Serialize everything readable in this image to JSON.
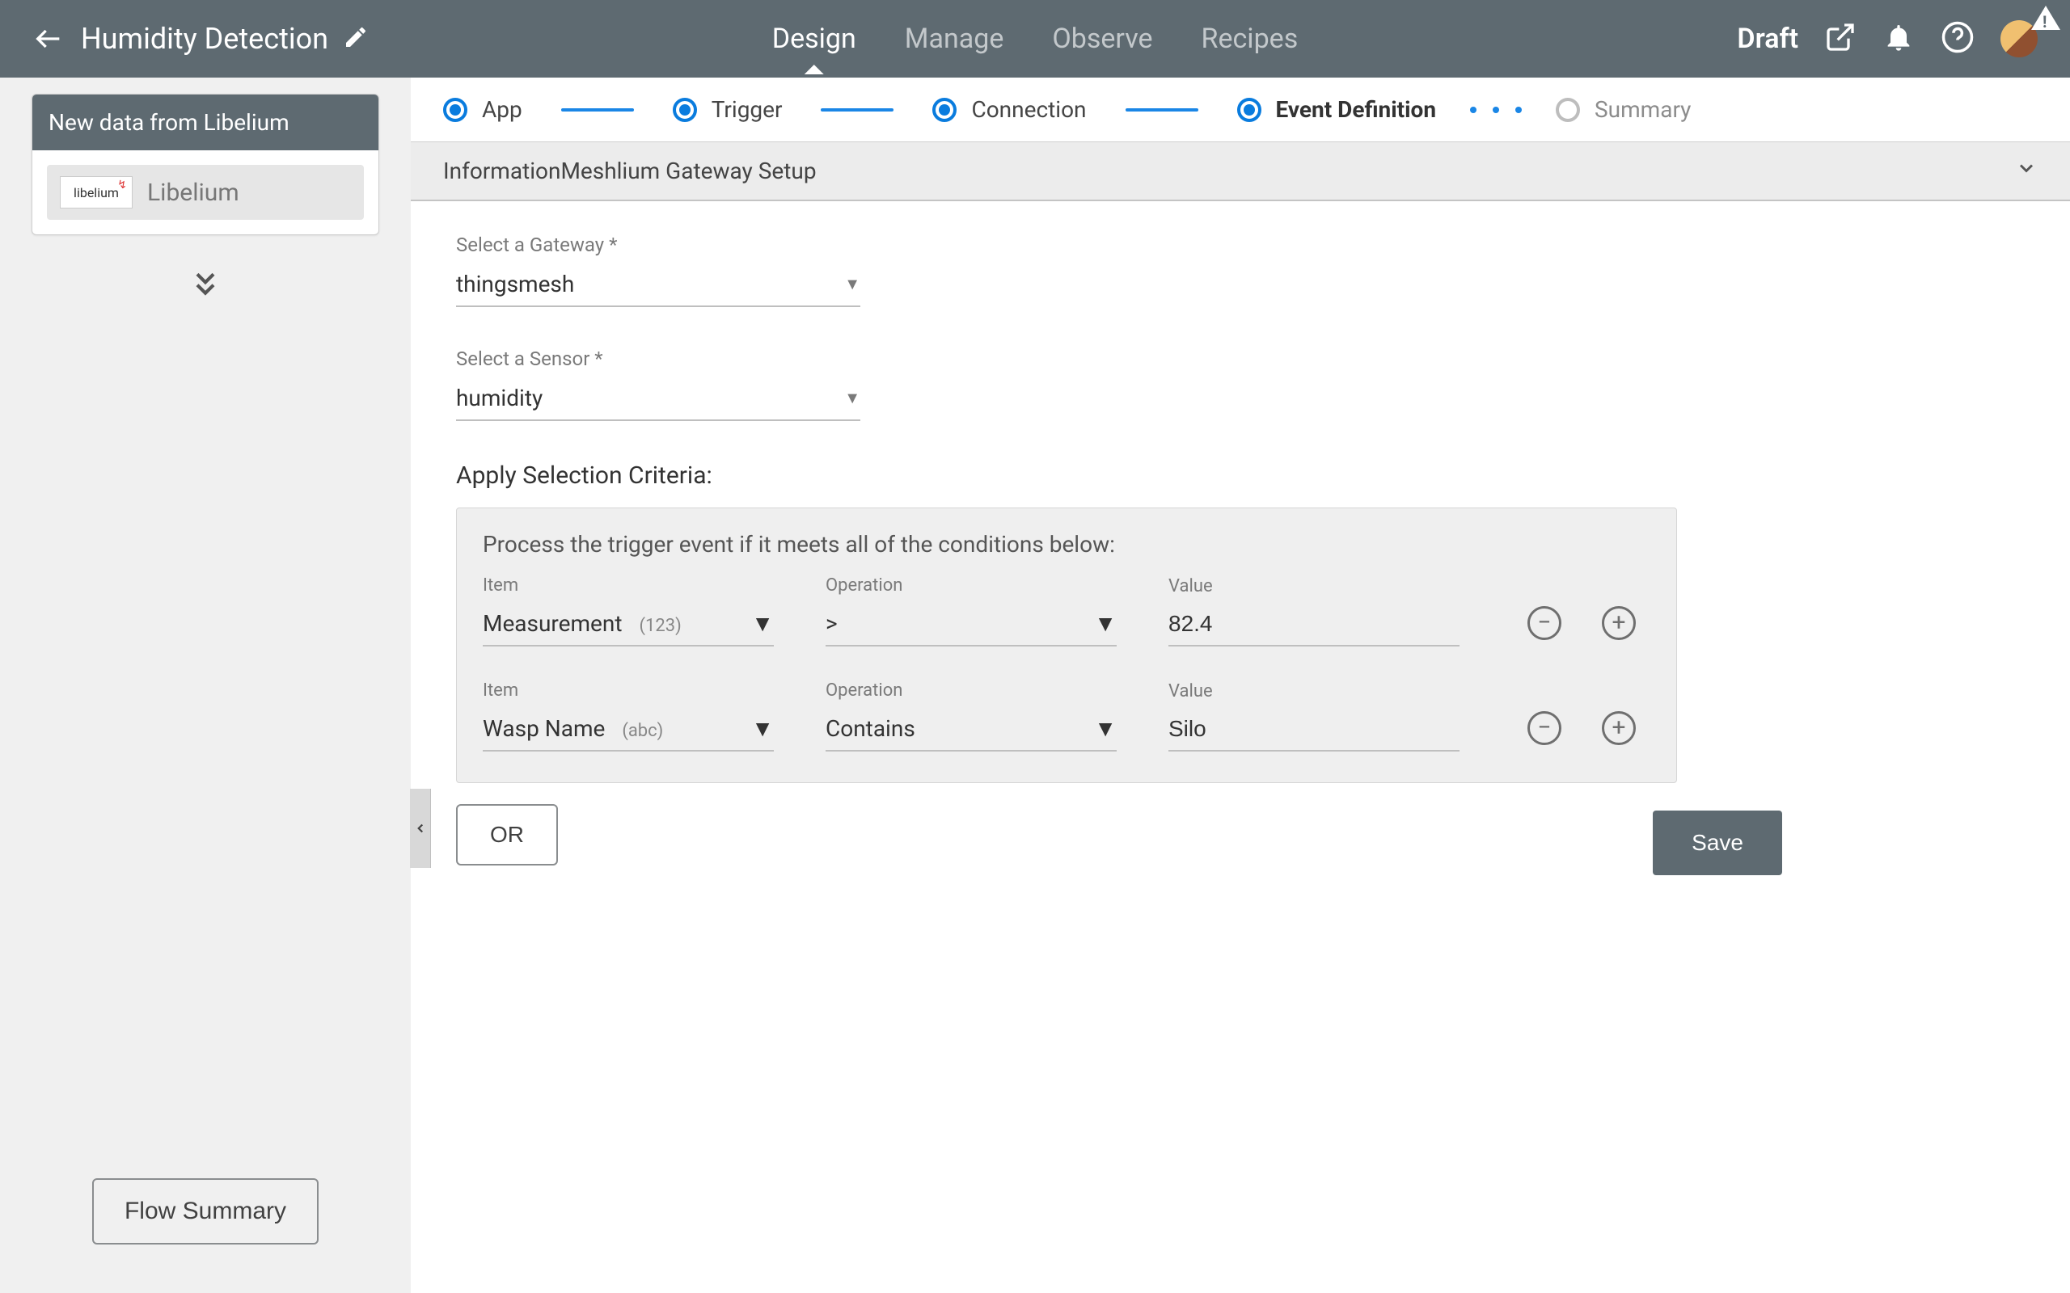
{
  "header": {
    "title": "Humidity Detection",
    "tabs": [
      "Design",
      "Manage",
      "Observe",
      "Recipes"
    ],
    "active_tab": 0,
    "status": "Draft"
  },
  "sidebar": {
    "card_title": "New data from Libelium",
    "block_logo_text": "libelium",
    "block_label": "Libelium",
    "flow_summary_btn": "Flow Summary"
  },
  "stepper": {
    "steps": [
      {
        "label": "App",
        "state": "done"
      },
      {
        "label": "Trigger",
        "state": "done"
      },
      {
        "label": "Connection",
        "state": "done"
      },
      {
        "label": "Event Definition",
        "state": "current"
      },
      {
        "label": "Summary",
        "state": "pending"
      }
    ]
  },
  "section": {
    "title": "InformationMeshlium Gateway Setup"
  },
  "form": {
    "gateway_label": "Select a Gateway *",
    "gateway_value": "thingsmesh",
    "sensor_label": "Select a Sensor *",
    "sensor_value": "humidity",
    "criteria_title": "Apply Selection Criteria:",
    "criteria_desc": "Process the trigger event if it meets all of the conditions below:",
    "item_label": "Item",
    "operation_label": "Operation",
    "value_label": "Value",
    "conditions": [
      {
        "item": "Measurement",
        "item_type": "(123)",
        "operation": ">",
        "value": "82.4"
      },
      {
        "item": "Wasp Name",
        "item_type": "(abc)",
        "operation": "Contains",
        "value": "Silo"
      }
    ],
    "or_btn": "OR",
    "save_btn": "Save"
  }
}
